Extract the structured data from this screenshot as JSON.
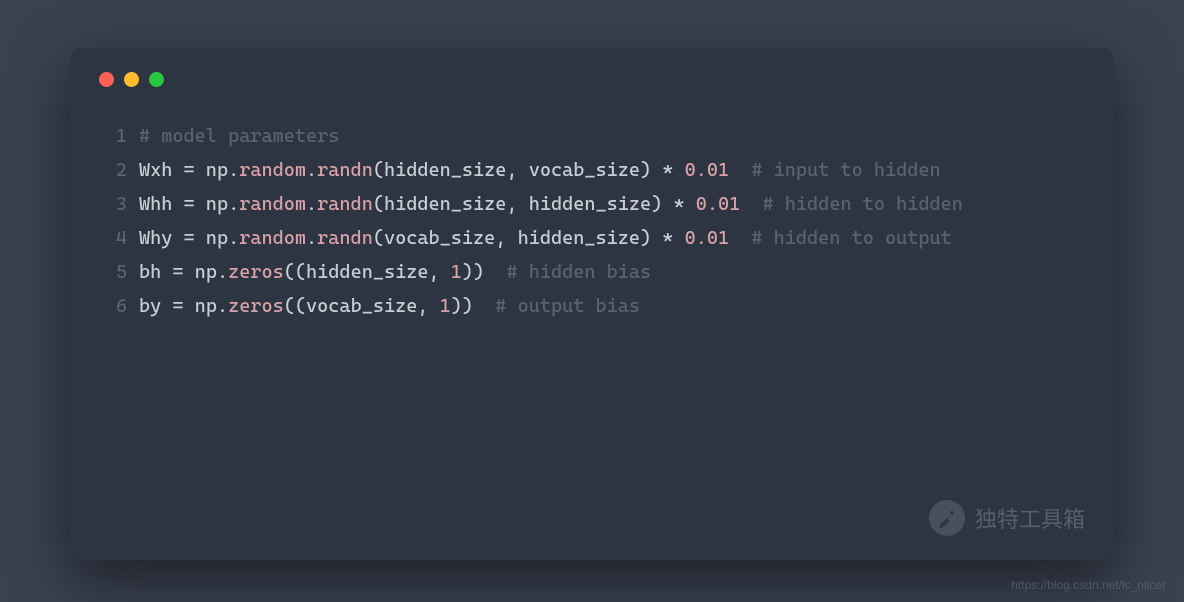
{
  "watermark": {
    "badge_text": "独特工具箱",
    "footer_text": "https://blog.csdn.net/lc_nlicer"
  },
  "code": {
    "lines": [
      {
        "num": "1",
        "tokens": [
          {
            "cls": "tok-comment",
            "t": "# model parameters"
          }
        ]
      },
      {
        "num": "2",
        "tokens": [
          {
            "cls": "tok-name",
            "t": "Wxh "
          },
          {
            "cls": "tok-op",
            "t": "="
          },
          {
            "cls": "tok-name",
            "t": " np"
          },
          {
            "cls": "tok-punct",
            "t": "."
          },
          {
            "cls": "tok-attr",
            "t": "random"
          },
          {
            "cls": "tok-punct",
            "t": "."
          },
          {
            "cls": "tok-attr",
            "t": "randn"
          },
          {
            "cls": "tok-punct",
            "t": "("
          },
          {
            "cls": "tok-name",
            "t": "hidden_size"
          },
          {
            "cls": "tok-punct",
            "t": ", "
          },
          {
            "cls": "tok-name",
            "t": "vocab_size"
          },
          {
            "cls": "tok-punct",
            "t": ")"
          },
          {
            "cls": "tok-star",
            "t": " * "
          },
          {
            "cls": "tok-num",
            "t": "0.01"
          },
          {
            "cls": "tok-comment",
            "t": "  # input to hidden"
          }
        ]
      },
      {
        "num": "3",
        "tokens": [
          {
            "cls": "tok-name",
            "t": "Whh "
          },
          {
            "cls": "tok-op",
            "t": "="
          },
          {
            "cls": "tok-name",
            "t": " np"
          },
          {
            "cls": "tok-punct",
            "t": "."
          },
          {
            "cls": "tok-attr",
            "t": "random"
          },
          {
            "cls": "tok-punct",
            "t": "."
          },
          {
            "cls": "tok-attr",
            "t": "randn"
          },
          {
            "cls": "tok-punct",
            "t": "("
          },
          {
            "cls": "tok-name",
            "t": "hidden_size"
          },
          {
            "cls": "tok-punct",
            "t": ", "
          },
          {
            "cls": "tok-name",
            "t": "hidden_size"
          },
          {
            "cls": "tok-punct",
            "t": ")"
          },
          {
            "cls": "tok-star",
            "t": " * "
          },
          {
            "cls": "tok-num",
            "t": "0.01"
          },
          {
            "cls": "tok-comment",
            "t": "  # hidden to hidden"
          }
        ]
      },
      {
        "num": "4",
        "tokens": [
          {
            "cls": "tok-name",
            "t": "Why "
          },
          {
            "cls": "tok-op",
            "t": "="
          },
          {
            "cls": "tok-name",
            "t": " np"
          },
          {
            "cls": "tok-punct",
            "t": "."
          },
          {
            "cls": "tok-attr",
            "t": "random"
          },
          {
            "cls": "tok-punct",
            "t": "."
          },
          {
            "cls": "tok-attr",
            "t": "randn"
          },
          {
            "cls": "tok-punct",
            "t": "("
          },
          {
            "cls": "tok-name",
            "t": "vocab_size"
          },
          {
            "cls": "tok-punct",
            "t": ", "
          },
          {
            "cls": "tok-name",
            "t": "hidden_size"
          },
          {
            "cls": "tok-punct",
            "t": ")"
          },
          {
            "cls": "tok-star",
            "t": " * "
          },
          {
            "cls": "tok-num",
            "t": "0.01"
          },
          {
            "cls": "tok-comment",
            "t": "  # hidden to output"
          }
        ]
      },
      {
        "num": "5",
        "tokens": [
          {
            "cls": "tok-name",
            "t": "bh "
          },
          {
            "cls": "tok-op",
            "t": "="
          },
          {
            "cls": "tok-name",
            "t": " np"
          },
          {
            "cls": "tok-punct",
            "t": "."
          },
          {
            "cls": "tok-attr",
            "t": "zeros"
          },
          {
            "cls": "tok-punct",
            "t": "(("
          },
          {
            "cls": "tok-name",
            "t": "hidden_size"
          },
          {
            "cls": "tok-punct",
            "t": ", "
          },
          {
            "cls": "tok-num",
            "t": "1"
          },
          {
            "cls": "tok-punct",
            "t": "))"
          },
          {
            "cls": "tok-comment",
            "t": "  # hidden bias"
          }
        ]
      },
      {
        "num": "6",
        "tokens": [
          {
            "cls": "tok-name",
            "t": "by "
          },
          {
            "cls": "tok-op",
            "t": "="
          },
          {
            "cls": "tok-name",
            "t": " np"
          },
          {
            "cls": "tok-punct",
            "t": "."
          },
          {
            "cls": "tok-attr",
            "t": "zeros"
          },
          {
            "cls": "tok-punct",
            "t": "(("
          },
          {
            "cls": "tok-name",
            "t": "vocab_size"
          },
          {
            "cls": "tok-punct",
            "t": ", "
          },
          {
            "cls": "tok-num",
            "t": "1"
          },
          {
            "cls": "tok-punct",
            "t": "))"
          },
          {
            "cls": "tok-comment",
            "t": "  # output bias"
          }
        ]
      }
    ]
  }
}
